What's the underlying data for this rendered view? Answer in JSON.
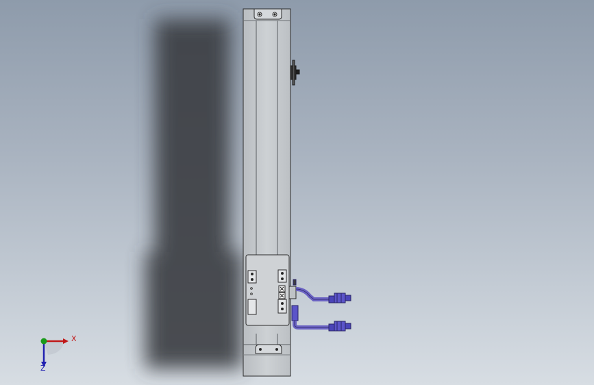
{
  "viewport": {
    "background_top": "#8e9bab",
    "background_bottom": "#d7dde3"
  },
  "model": {
    "actuator_body_color": "#c6cacd",
    "outline_color": "#2b2b2b",
    "shadow_color": "#3a3d42",
    "cable_color": "#6a62c2",
    "cable_connector_color": "#4a44b8"
  },
  "triad": {
    "x_label": "X",
    "z_label": "Z",
    "x_color": "#c01818",
    "y_color": "#1a9a1a",
    "z_color": "#2020b0"
  }
}
